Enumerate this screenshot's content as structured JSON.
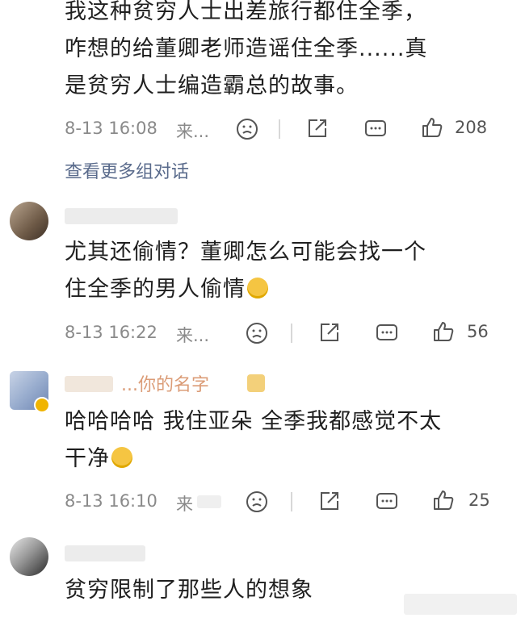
{
  "comments": [
    {
      "text_line1": "我这种贫穷人士出差旅行都住全季，",
      "text_line2": "咋想的给董卿老师造谣住全季......真",
      "text_line3": "是贫穷人士编造霸总的故事。",
      "time": "8-13 16:08",
      "source": "来...",
      "likes": "208",
      "more_link": "查看更多组对话"
    },
    {
      "text_line1": "尤其还偷情？董卿怎么可能会找一个",
      "text_line2": "住全季的男人偷情",
      "time": "8-13 16:22",
      "source": "来...",
      "likes": "56"
    },
    {
      "username_partial": "...你的名字",
      "text_line1": "哈哈哈哈 我住亚朵 全季我都感觉不太",
      "text_line2": "干净",
      "time": "8-13 16:10",
      "source": "来",
      "likes": "25"
    },
    {
      "text_line1": "贫穷限制了那些人的想象"
    }
  ],
  "icons": {
    "dislike": "sad-face-icon",
    "share": "share-icon",
    "reply": "comment-icon",
    "like": "thumbs-up-icon",
    "emoji": "laugh-cry-emoji-icon"
  },
  "colors": {
    "text": "#1f1f1f",
    "meta": "#8a8a8a",
    "link": "#5a6b8c"
  }
}
